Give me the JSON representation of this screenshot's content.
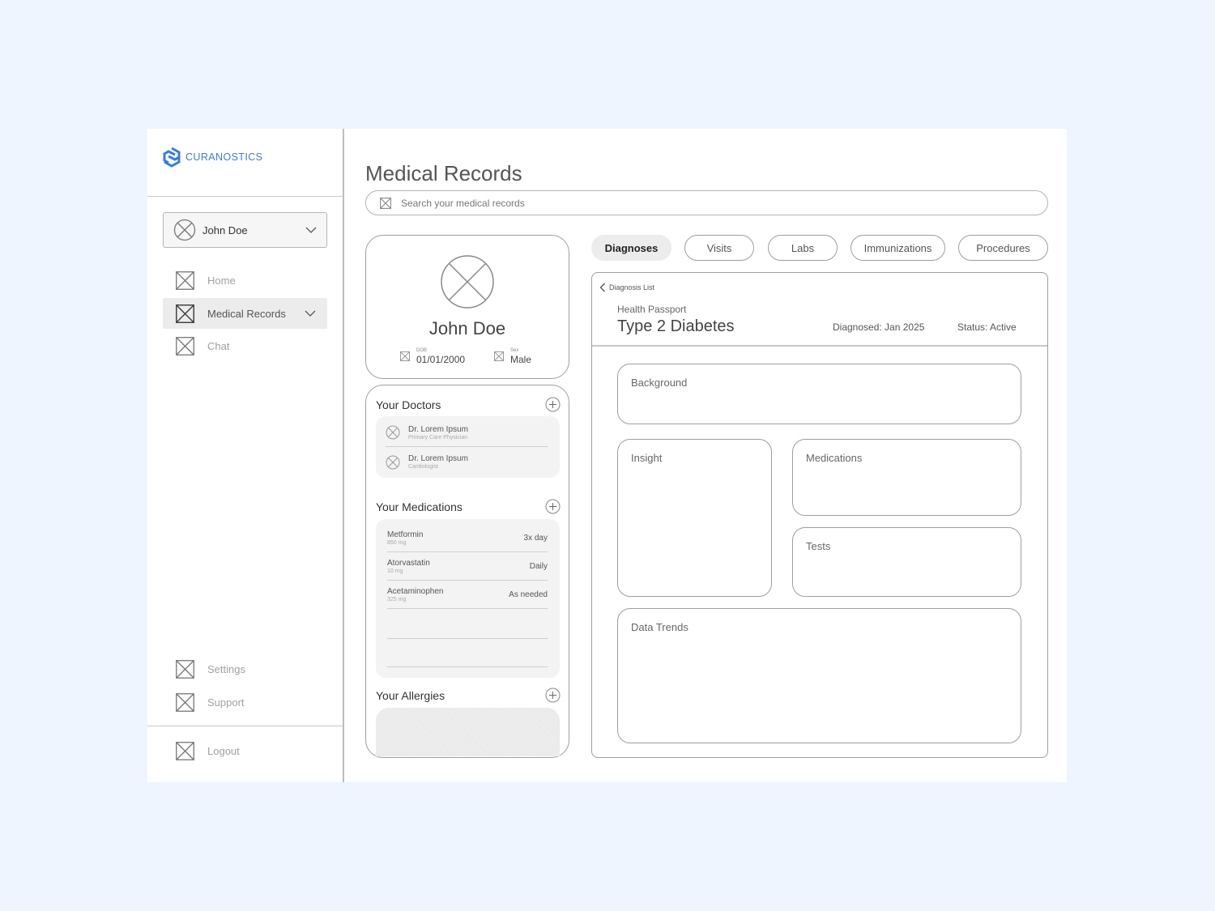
{
  "app": {
    "brand": "CURANOSTICS",
    "accent": "#3a7be0",
    "background": "#eef5fe"
  },
  "sidebar": {
    "user": {
      "name": "John Doe"
    },
    "items": [
      {
        "label": "Home",
        "icon": "placeholder-icon"
      },
      {
        "label": "Medical Records",
        "icon": "placeholder-icon",
        "active": true
      },
      {
        "label": "Chat",
        "icon": "placeholder-icon"
      }
    ],
    "bottom_items": [
      {
        "label": "Settings",
        "icon": "placeholder-icon"
      },
      {
        "label": "Support",
        "icon": "placeholder-icon"
      }
    ],
    "logout": {
      "label": "Logout",
      "icon": "placeholder-icon"
    }
  },
  "main": {
    "title": "Medical Records",
    "search": {
      "placeholder": "Search your medical records"
    }
  },
  "profile": {
    "name": "John Doe",
    "dob_label": "DOB",
    "dob": "01/01/2000",
    "sex_label": "Sex",
    "sex": "Male"
  },
  "doctors": {
    "title": "Your Doctors",
    "items": [
      {
        "name": "Dr. Lorem Ipsum",
        "role": "Primary Care Physician"
      },
      {
        "name": "Dr. Lorem Ipsum",
        "role": "Cardiologist"
      }
    ]
  },
  "medications": {
    "title": "Your Medications",
    "items": [
      {
        "name": "Metformin",
        "dose": "850 mg",
        "frequency": "3x day"
      },
      {
        "name": "Atorvastatin",
        "dose": "10 mg",
        "frequency": "Daily"
      },
      {
        "name": "Acetaminophen",
        "dose": "325 mg",
        "frequency": "As needed"
      }
    ]
  },
  "allergies": {
    "title": "Your Allergies"
  },
  "tabs": [
    {
      "label": "Diagnoses",
      "active": true
    },
    {
      "label": "Visits"
    },
    {
      "label": "Labs"
    },
    {
      "label": "Immunizations"
    },
    {
      "label": "Procedures"
    }
  ],
  "detail": {
    "back_label": "Diagnosis List",
    "section_label": "Health Passport",
    "diagnosis": "Type 2 Diabetes",
    "diagnosed": "Diagnosed: Jan 2025",
    "status": "Status: Active",
    "boxes": {
      "background": "Background",
      "insight": "Insight",
      "medications": "Medications",
      "tests": "Tests",
      "data_trends": "Data Trends"
    }
  }
}
